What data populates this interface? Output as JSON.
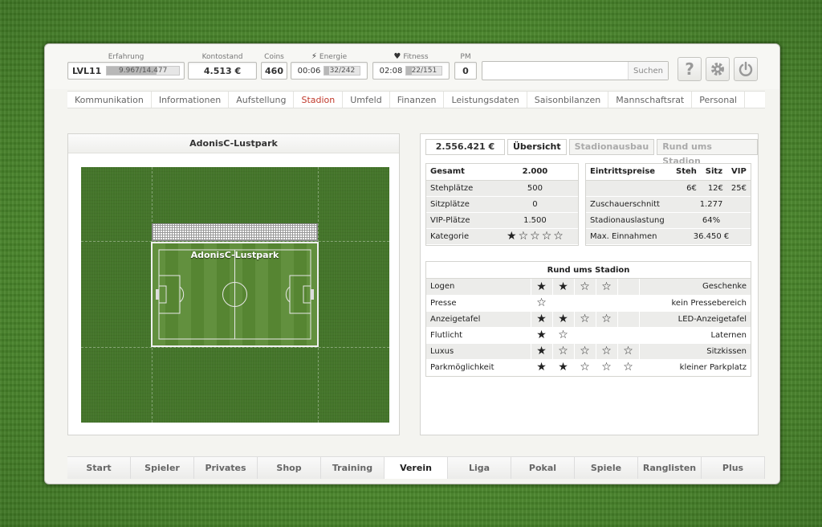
{
  "stats": {
    "erfahrung_label": "Erfahrung",
    "level": "LVL11",
    "xp": "9.967/14.477",
    "xp_fraction": 0.69,
    "kontostand_label": "Kontostand",
    "kontostand": "4.513 €",
    "coins_label": "Coins",
    "coins": "460",
    "energie_label": "Energie",
    "energie_time": "00:06",
    "energie_value": "32/242",
    "energie_fraction": 0.13,
    "fitness_label": "Fitness",
    "fitness_time": "02:08",
    "fitness_value": "22/151",
    "fitness_fraction": 0.15,
    "pm_label": "PM",
    "pm": "0"
  },
  "search": {
    "placeholder": "",
    "button": "Suchen"
  },
  "icons": {
    "help": "help-icon",
    "settings": "gear-icon",
    "power": "power-icon"
  },
  "nav_tabs": [
    {
      "label": "Kommunikation"
    },
    {
      "label": "Informationen"
    },
    {
      "label": "Aufstellung"
    },
    {
      "label": "Stadion"
    },
    {
      "label": "Umfeld"
    },
    {
      "label": "Finanzen"
    },
    {
      "label": "Leistungsdaten"
    },
    {
      "label": "Saisonbilanzen"
    },
    {
      "label": "Mannschaftsrat"
    },
    {
      "label": "Personal"
    }
  ],
  "active_nav": "Stadion",
  "stadium": {
    "title": "AdonisC-Lustpark",
    "field_name": "AdonisC-Lustpark"
  },
  "right_tabs": {
    "money": "2.556.421 €",
    "overview": "Übersicht",
    "ausbau": "Stadionausbau",
    "rund": "Rund ums Stadion"
  },
  "capacity": {
    "header_label": "Gesamt",
    "header_value": "2.000",
    "rows": [
      {
        "label": "Stehplätze",
        "value": "500"
      },
      {
        "label": "Sitzplätze",
        "value": "0"
      },
      {
        "label": "VIP-Plätze",
        "value": "1.500"
      }
    ],
    "kategorie_label": "Kategorie",
    "kategorie_stars": 1
  },
  "prices": {
    "header_label": "Eintrittspreise",
    "col_steh": "Steh",
    "col_sitz": "Sitz",
    "col_vip": "VIP",
    "steh": "6€",
    "sitz": "12€",
    "vip": "25€",
    "rows": [
      {
        "label": "Zuschauerschnitt",
        "value": "1.277"
      },
      {
        "label": "Stadionauslastung",
        "value": "64%"
      },
      {
        "label": "Max. Einnahmen",
        "value": "36.450 €"
      }
    ]
  },
  "rund": {
    "title": "Rund ums Stadion",
    "rows": [
      {
        "label": "Logen",
        "filled": 2,
        "total": 4,
        "value": "Geschenke"
      },
      {
        "label": "Presse",
        "filled": 0,
        "total": 1,
        "value": "kein Pressebereich"
      },
      {
        "label": "Anzeigetafel",
        "filled": 2,
        "total": 4,
        "value": "LED-Anzeigetafel"
      },
      {
        "label": "Flutlicht",
        "filled": 1,
        "total": 2,
        "value": "Laternen"
      },
      {
        "label": "Luxus",
        "filled": 1,
        "total": 5,
        "value": "Sitzkissen"
      },
      {
        "label": "Parkmöglichkeit",
        "filled": 2,
        "total": 5,
        "value": "kleiner Parkplatz"
      }
    ]
  },
  "bottom_nav": [
    {
      "label": "Start"
    },
    {
      "label": "Spieler"
    },
    {
      "label": "Privates"
    },
    {
      "label": "Shop"
    },
    {
      "label": "Training"
    },
    {
      "label": "Verein"
    },
    {
      "label": "Liga"
    },
    {
      "label": "Pokal"
    },
    {
      "label": "Spiele"
    },
    {
      "label": "Ranglisten"
    },
    {
      "label": "Plus"
    }
  ],
  "active_bottom": "Verein"
}
